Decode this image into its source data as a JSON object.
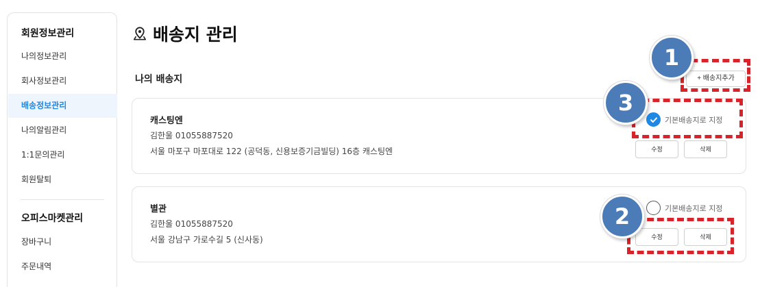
{
  "sidebar": {
    "section1_title": "회원정보관리",
    "section1_items": [
      {
        "label": "나의정보관리",
        "active": false
      },
      {
        "label": "회사정보관리",
        "active": false
      },
      {
        "label": "배송정보관리",
        "active": true
      },
      {
        "label": "나의알림관리",
        "active": false
      },
      {
        "label": "1:1문의관리",
        "active": false
      },
      {
        "label": "회원탈퇴",
        "active": false
      }
    ],
    "section2_title": "오피스마켓관리",
    "section2_items": [
      {
        "label": "장바구니"
      },
      {
        "label": "주문내역"
      }
    ]
  },
  "page": {
    "title": "배송지 관리",
    "title_icon": "map-pin-icon",
    "section_label": "나의 배송지",
    "add_button_label": "+ 배송지추가"
  },
  "addresses": [
    {
      "name": "캐스팅엔",
      "phone": "김한울 01055887520",
      "address": "서울 마포구 마포대로 122 (공덕동, 신용보증기금빌딩) 16층 캐스팅엔",
      "default_label": "기본배송지로 지정",
      "is_default": true,
      "edit_label": "수정",
      "delete_label": "삭제"
    },
    {
      "name": "별관",
      "phone": "김한울 01055887520",
      "address": "서울 강남구 가로수길 5 (신사동)",
      "default_label": "기본배송지로 지정",
      "is_default": false,
      "edit_label": "수정",
      "delete_label": "삭제"
    }
  ],
  "callouts": [
    "1",
    "2",
    "3"
  ],
  "colors": {
    "accent": "#1e88e5",
    "active_bg": "#eef5fc",
    "callout": "#4b7cb8",
    "highlight_dash": "#d8232a"
  }
}
